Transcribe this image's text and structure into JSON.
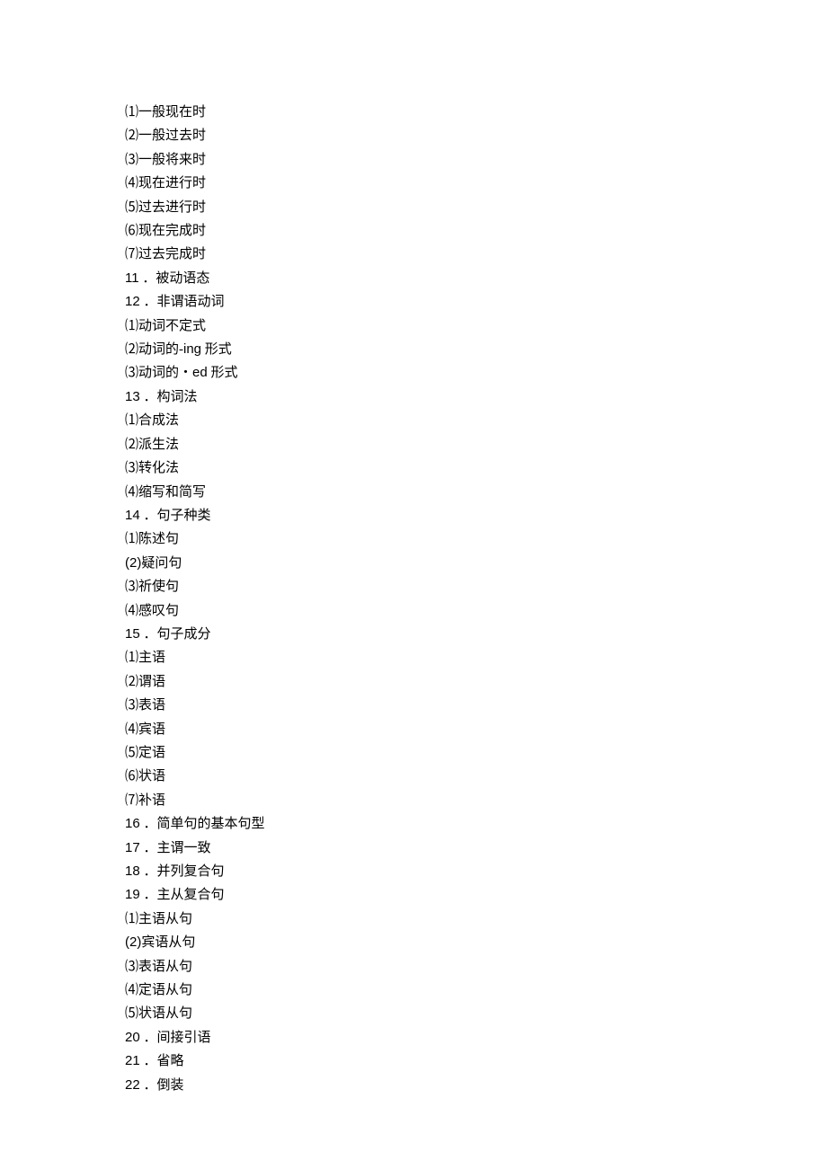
{
  "lines": [
    {
      "text": "⑴一般现在时"
    },
    {
      "text": "⑵一般过去时"
    },
    {
      "text": "⑶一般将来时"
    },
    {
      "text": "⑷现在进行时"
    },
    {
      "text": "⑸过去进行时"
    },
    {
      "text": "⑹现在完成时"
    },
    {
      "text": "⑺过去完成时"
    },
    {
      "num": "11",
      "text": " ．被动语态"
    },
    {
      "num": "12",
      "text": " ．非谓语动词"
    },
    {
      "text": "⑴动词不定式"
    },
    {
      "pre": "⑵动词的-",
      "sans": "ing",
      "post": " 形式"
    },
    {
      "pre": "⑶动词的・",
      "sans": "ed",
      "post": " 形式"
    },
    {
      "num": "13",
      "text": " ．构词法"
    },
    {
      "text": "⑴合成法"
    },
    {
      "text": "⑵派生法"
    },
    {
      "text": "⑶转化法"
    },
    {
      "text": "⑷缩写和简写"
    },
    {
      "num": "14",
      "text": " ．句子种类"
    },
    {
      "text": "⑴陈述句"
    },
    {
      "sans": "(2)",
      "post": "疑问句"
    },
    {
      "text": "⑶祈使句"
    },
    {
      "text": "⑷感叹句"
    },
    {
      "num": "15",
      "text": " ．句子成分"
    },
    {
      "text": "⑴主语"
    },
    {
      "text": "⑵谓语"
    },
    {
      "text": "⑶表语"
    },
    {
      "text": "⑷宾语"
    },
    {
      "text": "⑸定语"
    },
    {
      "text": "⑹状语"
    },
    {
      "text": "⑺补语"
    },
    {
      "num": "16",
      "text": " ．简单句的基本句型"
    },
    {
      "num": "17",
      "text": " ．主谓一致"
    },
    {
      "num": "18",
      "text": " ．并列复合句"
    },
    {
      "num": "19",
      "text": " ．主从复合句"
    },
    {
      "text": "⑴主语从句"
    },
    {
      "sans": "(2)",
      "post": "宾语从句"
    },
    {
      "text": "⑶表语从句"
    },
    {
      "text": "⑷定语从句"
    },
    {
      "text": "⑸状语从句"
    },
    {
      "num": "20",
      "text": " ．间接引语"
    },
    {
      "num": "21",
      "text": " ．省略"
    },
    {
      "num": "22",
      "text": " ．倒装"
    }
  ]
}
